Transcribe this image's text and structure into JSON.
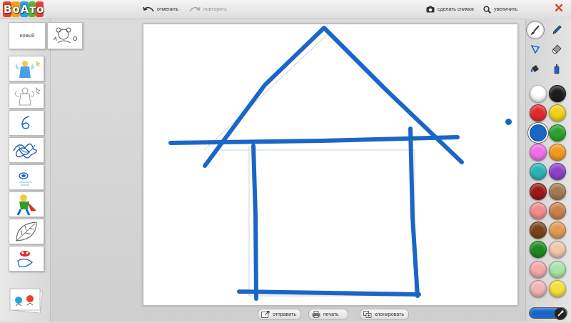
{
  "app": {
    "logo": "ВоАто",
    "close_symbol": "✕"
  },
  "toolbar": {
    "undo": {
      "label": "отменить",
      "icon": "undo-arrow-icon"
    },
    "redo": {
      "label": "повторить",
      "icon": "redo-arrow-icon"
    },
    "snapshot": {
      "label": "сделать снимок",
      "icon": "camera-icon"
    },
    "zoom": {
      "label": "увеличить",
      "icon": "magnifier-icon"
    }
  },
  "sidebar": {
    "new_label": "новый",
    "thumbnails": [
      {
        "content": "fairy"
      },
      {
        "content": "fairy-outline"
      },
      {
        "content": "scribble-6"
      },
      {
        "content": "blue-scribble"
      },
      {
        "content": "swirl"
      },
      {
        "content": "superhero"
      },
      {
        "content": "leaf"
      },
      {
        "content": "character"
      }
    ]
  },
  "tools": [
    {
      "name": "brush",
      "active": true
    },
    {
      "name": "marker",
      "active": false
    },
    {
      "name": "shape",
      "active": false
    },
    {
      "name": "eraser",
      "active": false
    },
    {
      "name": "fill-bucket",
      "active": false
    },
    {
      "name": "spray",
      "active": false
    }
  ],
  "palette": {
    "colors": [
      "#ffffff",
      "#1c1c1c",
      "#e02a2a",
      "#efd21c",
      "#1a66c8",
      "#2aa12a",
      "#ee6fe8",
      "#f39a1c",
      "#2ab3b3",
      "#8a42c8",
      "#9c1818",
      "#a07a52",
      "#f28c8c",
      "#c8824a",
      "#7a4318",
      "#e39a52",
      "#1e8a1e",
      "#f0c8a8",
      "#f5a8a8",
      "#a8e6a8",
      "#f0b4b4",
      "#f5e03a"
    ],
    "selected_index": 4,
    "current_color": "#1a66c8"
  },
  "drawing": {
    "stroke_color": "#1a66c8"
  },
  "bottom": {
    "send": {
      "label": "отправить",
      "icon": "send-icon"
    },
    "print": {
      "label": "печать",
      "icon": "printer-icon"
    },
    "clone": {
      "label": "клонировать",
      "icon": "clone-icon"
    }
  }
}
